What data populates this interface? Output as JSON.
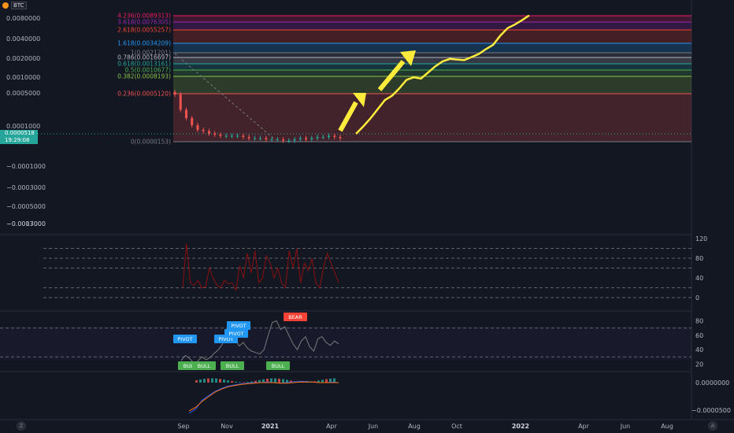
{
  "app": {
    "symbol": "BTC",
    "coin_icon": "bitcoin-icon",
    "zoom_label": "Z",
    "auto_label": "A"
  },
  "price_tag": {
    "price": "0.0000518",
    "countdown": "19:29:08"
  },
  "colors": {
    "background": "#131722",
    "grid": "#2a2e39",
    "candle_up": "#26a69a",
    "candle_down": "#ef5350",
    "arrow": "#ffeb3b",
    "rsi_line": "#8b0f0f",
    "stoch_line": "#7a7a7a",
    "pivot_tag": "#2196f3",
    "bull_tag": "#4caf50",
    "bear_tag": "#f44336"
  },
  "chart_data": [
    {
      "type": "line",
      "name": "main-price-pane",
      "y_tick_labels": [
        "0.0080000",
        "0.0040000",
        "0.0020000",
        "0.0010000",
        "0.0005000",
        "0.0001000",
        "−0.0001000",
        "−0.0003000",
        "−0.0005000",
        "−0.0007000",
        "−0.0013000"
      ],
      "x_tick_labels": [
        "Sep",
        "Nov",
        "2021",
        "Apr",
        "Jun",
        "Aug",
        "Oct",
        "2022",
        "Apr",
        "Jun",
        "Aug"
      ],
      "x_tick_bold": [
        false,
        false,
        true,
        false,
        false,
        false,
        false,
        true,
        false,
        false,
        false
      ],
      "fib_levels": [
        {
          "ratio": "4.236",
          "price": "0.0089313",
          "label": "4.236(0.0089313)",
          "color": "#e91e63"
        },
        {
          "ratio": "3.618",
          "price": "0.0076305",
          "label": "3.618(0.0076305)",
          "color": "#9c27b0"
        },
        {
          "ratio": "2.618",
          "price": "0.0055257",
          "label": "2.618(0.0055257)",
          "color": "#f44336"
        },
        {
          "ratio": "1.618",
          "price": "0.0034209",
          "label": "1.618(0.0034209)",
          "color": "#2196f3"
        },
        {
          "ratio": "1",
          "price": "0.0021201",
          "label": "1(0.0021201)",
          "color": "#787b86"
        },
        {
          "ratio": "0.786",
          "price": "0.0016697",
          "label": "0.786(0.0016697)",
          "color": "#b2b5be"
        },
        {
          "ratio": "0.618",
          "price": "0.0013161",
          "label": "0.618(0.0013161)",
          "color": "#26a69a"
        },
        {
          "ratio": "0.5",
          "price": "0.0010677",
          "label": "0.5(0.0010677)",
          "color": "#4caf50"
        },
        {
          "ratio": "0.382",
          "price": "0.0008193",
          "label": "0.382(0.0008193)",
          "color": "#8bc34a"
        },
        {
          "ratio": "0.236",
          "price": "0.0005120",
          "label": "0.236(0.0005120)",
          "color": "#ef5350"
        },
        {
          "ratio": "0",
          "price": "0.0000153",
          "label": "0(0.0000153)",
          "color": "#787b86"
        }
      ],
      "series": [
        {
          "values": [
            100,
            87,
            80,
            74,
            70,
            69,
            67,
            66,
            65,
            65,
            65,
            65,
            64,
            63,
            63,
            63,
            62,
            62,
            62,
            61,
            61,
            62,
            63,
            62,
            63,
            64,
            64,
            65,
            64,
            63
          ]
        },
        {
          "values": [
            0,
            12,
            25,
            40,
            55,
            62,
            74,
            88,
            92,
            90,
            100,
            110,
            118,
            122,
            121,
            120,
            125,
            130,
            138,
            145,
            160,
            172,
            178,
            185,
            193
          ]
        }
      ]
    },
    {
      "type": "line",
      "name": "rsi-pane",
      "y_tick_labels": [
        "120",
        "80",
        "40",
        "0"
      ],
      "ylim": [
        0,
        120
      ],
      "levels": [
        100,
        80,
        60,
        20,
        0
      ],
      "series": [
        {
          "values": [
            20,
            110,
            30,
            25,
            35,
            20,
            22,
            60,
            40,
            25,
            20,
            35,
            28,
            30,
            15,
            65,
            40,
            90,
            50,
            95,
            30,
            40,
            85,
            70,
            40,
            60,
            30,
            20,
            95,
            60,
            100,
            30,
            70,
            55,
            80,
            30,
            20,
            60,
            90,
            70,
            50,
            30
          ]
        }
      ]
    },
    {
      "type": "line",
      "name": "stochastic-pane",
      "y_tick_labels": [
        "80",
        "60",
        "40",
        "20"
      ],
      "ylim": [
        15,
        85
      ],
      "levels": [
        70,
        30
      ],
      "series": [
        {
          "values": [
            25,
            32,
            28,
            22,
            24,
            30,
            26,
            29,
            35,
            40,
            48,
            58,
            62,
            55,
            45,
            50,
            42,
            38,
            36,
            34,
            40,
            60,
            78,
            80,
            68,
            72,
            60,
            48,
            40,
            52,
            58,
            44,
            38,
            55,
            58,
            50,
            46,
            52,
            48
          ]
        }
      ],
      "annotations": [
        {
          "text": "PIVOT",
          "kind": "pivot"
        },
        {
          "text": "PIVOT",
          "kind": "pivot"
        },
        {
          "text": "PIVOT",
          "kind": "pivot"
        },
        {
          "text": "PIVOT",
          "kind": "pivot"
        },
        {
          "text": "BEAR",
          "kind": "bear"
        },
        {
          "text": "BULL",
          "kind": "bull"
        },
        {
          "text": "BULL",
          "kind": "bull"
        },
        {
          "text": "BULL",
          "kind": "bull"
        },
        {
          "text": "BULL",
          "kind": "bull"
        }
      ]
    },
    {
      "type": "line",
      "name": "macd-pane",
      "y_tick_labels": [
        "0.0000000",
        "−0.0000500"
      ],
      "series": [
        {
          "values": [
            -52,
            -45,
            -30,
            -22,
            -15,
            -10,
            -6,
            -4,
            -2,
            -1,
            0,
            0,
            1,
            0,
            -1,
            0,
            1,
            2,
            2,
            1,
            0,
            0,
            1,
            0
          ]
        },
        {
          "values": [
            -48,
            -42,
            -32,
            -24,
            -16,
            -11,
            -7,
            -5,
            -3,
            -2,
            -1,
            0,
            0,
            0,
            -1,
            -1,
            0,
            1,
            1,
            1,
            0,
            0,
            0,
            0
          ]
        }
      ]
    }
  ]
}
